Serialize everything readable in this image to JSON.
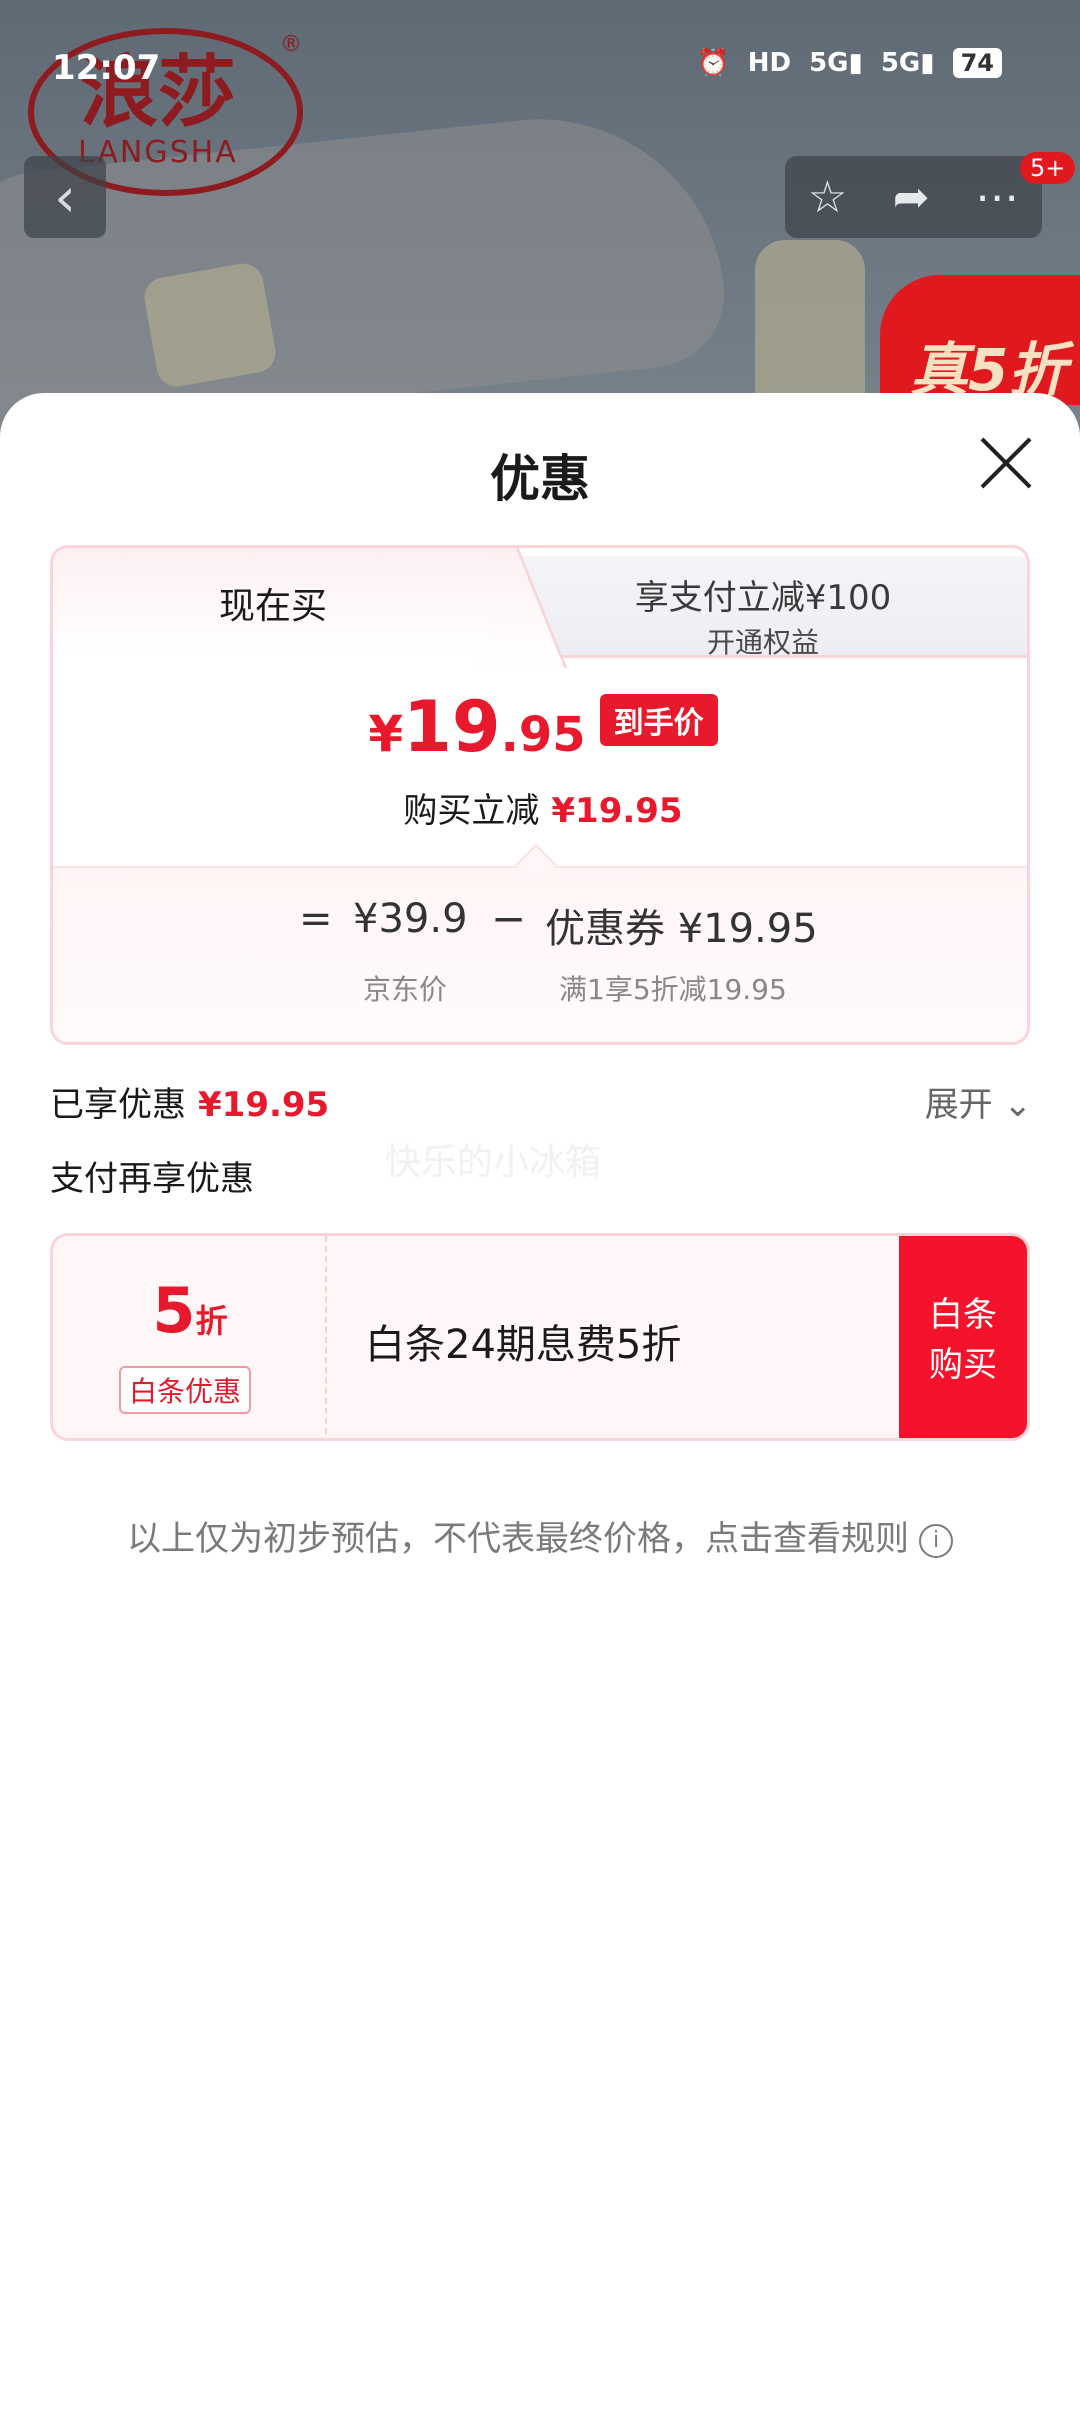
{
  "status_bar": {
    "time": "12:07",
    "hd": "HD",
    "net1": "5G",
    "net2": "5G",
    "battery": "74"
  },
  "product_bg": {
    "logo_cn": "浪莎",
    "logo_en": "LANGSHA",
    "logo_mark": "®",
    "promo": "真5折"
  },
  "nav": {
    "badge": "5+"
  },
  "sheet": {
    "title": "优惠",
    "tabs": {
      "now": "现在买",
      "pay_line1": "享支付立减¥100",
      "pay_line2": "开通权益"
    },
    "final_price": {
      "currency": "¥",
      "integer": "19",
      "decimal": ".95",
      "tag": "到手价"
    },
    "reduce": {
      "label": "购买立减",
      "value": "¥19.95"
    },
    "calc": {
      "eq": "=",
      "orig_price": "¥39.9",
      "minus": "−",
      "coupon": "优惠券 ¥19.95",
      "orig_label": "京东价",
      "coupon_label": "满1享5折减19.95"
    },
    "enjoyed": {
      "label": "已享优惠",
      "value": "¥19.95",
      "expand": "展开"
    },
    "pay_extra": "支付再享优惠",
    "watermark": "快乐的小冰箱",
    "offer": {
      "discount": "5",
      "unit": "折",
      "badge": "白条优惠",
      "desc": "白条24期息费5折",
      "buy": "白条购买"
    },
    "note": "以上仅为初步预估，不代表最终价格，点击查看规则"
  },
  "colors": {
    "accent": "#e8192c",
    "border": "#fbd4d9"
  }
}
